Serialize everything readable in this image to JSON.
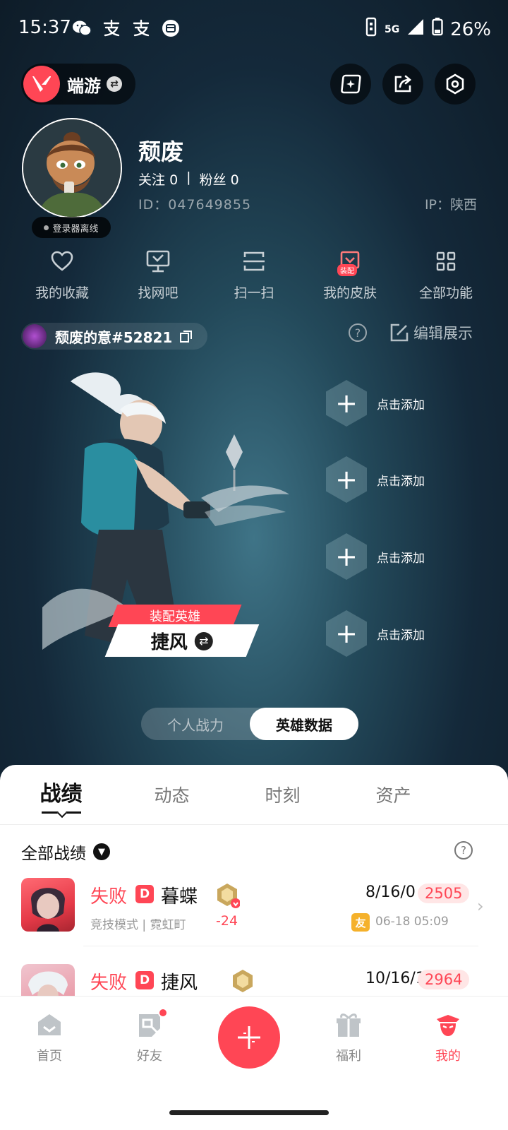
{
  "status_bar": {
    "time": "15:37",
    "network": "5G",
    "battery": "26%"
  },
  "header": {
    "game_name": "端游"
  },
  "profile": {
    "name": "颓废",
    "follow_label": "关注",
    "follow_count": "0",
    "fans_label": "粉丝",
    "fans_count": "0",
    "id_text": "ID：047649855",
    "ip_text": "IP：陕西",
    "status_badge": "登录器离线"
  },
  "quick_functions": [
    {
      "label": "我的收藏",
      "icon": "heart-icon"
    },
    {
      "label": "找网吧",
      "icon": "monitor-icon"
    },
    {
      "label": "扫一扫",
      "icon": "scan-icon"
    },
    {
      "label": "我的皮肤",
      "icon": "skin-icon",
      "badge": "装配"
    },
    {
      "label": "全部功能",
      "icon": "grid-icon"
    }
  ],
  "account": {
    "riot_id": "颓废的意#52821",
    "edit_label": "编辑展示"
  },
  "hero": {
    "equip_label": "装配英雄",
    "name": "捷风"
  },
  "add_slots": [
    {
      "label": "点击添加"
    },
    {
      "label": "点击添加"
    },
    {
      "label": "点击添加"
    },
    {
      "label": "点击添加"
    }
  ],
  "toggle": {
    "options": [
      "个人战力",
      "英雄数据"
    ],
    "selected": "英雄数据"
  },
  "sheet": {
    "tabs": [
      "战绩",
      "动态",
      "时刻",
      "资产"
    ],
    "active_tab": "战绩",
    "filter_label": "全部战绩"
  },
  "matches": [
    {
      "result": "失败",
      "mode_badge": "D",
      "agent": "暮蝶",
      "mode": "竞技模式 | 霓虹町",
      "rank_delta": "-24",
      "kda": "8/16/0",
      "score": "2505",
      "friend_badge": "友",
      "time": "06-18 05:09"
    },
    {
      "result": "失败",
      "mode_badge": "D",
      "agent": "捷风",
      "kda": "10/16/1",
      "score": "2964"
    }
  ],
  "bottom_nav": [
    {
      "label": "首页",
      "icon": "home-icon",
      "active": false
    },
    {
      "label": "好友",
      "icon": "friends-icon",
      "active": false
    },
    {
      "label": "福利",
      "icon": "gift-icon",
      "active": false
    },
    {
      "label": "我的",
      "icon": "profile-icon",
      "active": true
    }
  ],
  "colors": {
    "accent": "#ff4655",
    "background_dark": "#0f1c26",
    "sheet": "#ffffff"
  }
}
